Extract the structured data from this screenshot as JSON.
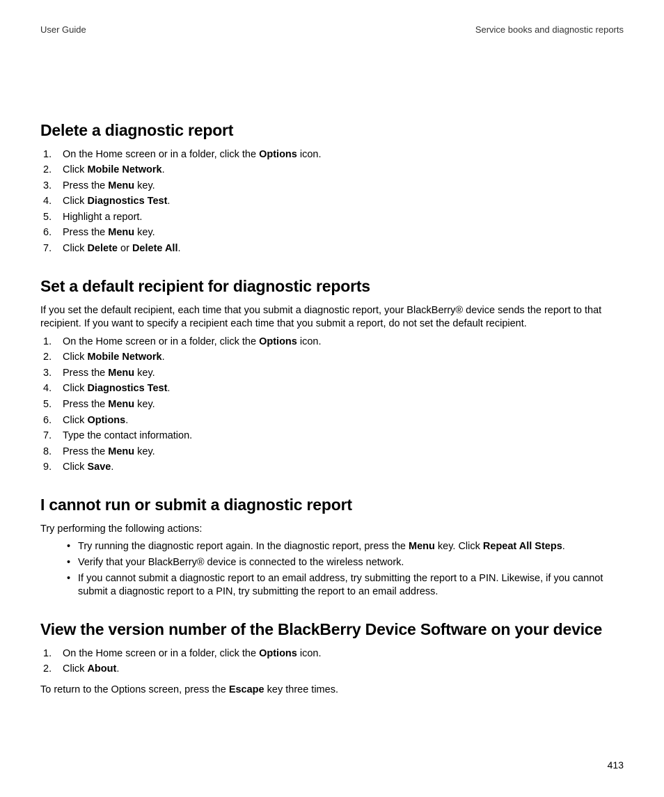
{
  "header": {
    "left": "User Guide",
    "right": "Service books and diagnostic reports"
  },
  "sections": {
    "delete": {
      "heading": "Delete a diagnostic report",
      "steps": [
        {
          "pre": "On the Home screen or in a folder, click the ",
          "bold": "Options",
          "post": " icon."
        },
        {
          "pre": "Click ",
          "bold": "Mobile Network",
          "post": "."
        },
        {
          "pre": "Press the ",
          "bold": "Menu",
          "post": " key."
        },
        {
          "pre": "Click ",
          "bold": "Diagnostics Test",
          "post": "."
        },
        {
          "pre": "Highlight a report.",
          "bold": "",
          "post": ""
        },
        {
          "pre": "Press the ",
          "bold": "Menu",
          "post": " key."
        },
        {
          "pre": "Click ",
          "bold": "Delete",
          "mid": " or ",
          "bold2": "Delete All",
          "post": "."
        }
      ]
    },
    "recipient": {
      "heading": "Set a default recipient for diagnostic reports",
      "intro": "If you set the default recipient, each time that you submit a diagnostic report, your BlackBerry® device sends the report to that recipient. If you want to specify a recipient each time that you submit a report, do not set the default recipient.",
      "steps": [
        {
          "pre": "On the Home screen or in a folder, click the ",
          "bold": "Options",
          "post": " icon."
        },
        {
          "pre": "Click ",
          "bold": "Mobile Network",
          "post": "."
        },
        {
          "pre": "Press the ",
          "bold": "Menu",
          "post": " key."
        },
        {
          "pre": "Click ",
          "bold": "Diagnostics Test",
          "post": "."
        },
        {
          "pre": "Press the ",
          "bold": "Menu",
          "post": " key."
        },
        {
          "pre": "Click ",
          "bold": "Options",
          "post": "."
        },
        {
          "pre": "Type the contact information.",
          "bold": "",
          "post": ""
        },
        {
          "pre": "Press the ",
          "bold": "Menu",
          "post": " key."
        },
        {
          "pre": "Click ",
          "bold": "Save",
          "post": "."
        }
      ]
    },
    "cannot": {
      "heading": "I cannot run or submit a diagnostic report",
      "intro": "Try performing the following actions:",
      "bullets": [
        {
          "pre": "Try running the diagnostic report again. In the diagnostic report, press the ",
          "bold": "Menu",
          "mid": " key. Click ",
          "bold2": "Repeat All Steps",
          "post": "."
        },
        {
          "pre": "Verify that your BlackBerry® device is connected to the wireless network.",
          "bold": "",
          "post": ""
        },
        {
          "pre": "If you cannot submit a diagnostic report to an email address, try submitting the report to a PIN. Likewise, if you cannot submit a diagnostic report to a PIN, try submitting the report to an email address.",
          "bold": "",
          "post": ""
        }
      ]
    },
    "version": {
      "heading": "View the version number of the BlackBerry Device Software on your device",
      "steps": [
        {
          "pre": "On the Home screen or in a folder, click the ",
          "bold": "Options",
          "post": " icon."
        },
        {
          "pre": "Click ",
          "bold": "About",
          "post": "."
        }
      ],
      "after_pre": "To return to the Options screen, press the ",
      "after_bold": "Escape",
      "after_post": " key three times."
    }
  },
  "page_number": "413"
}
